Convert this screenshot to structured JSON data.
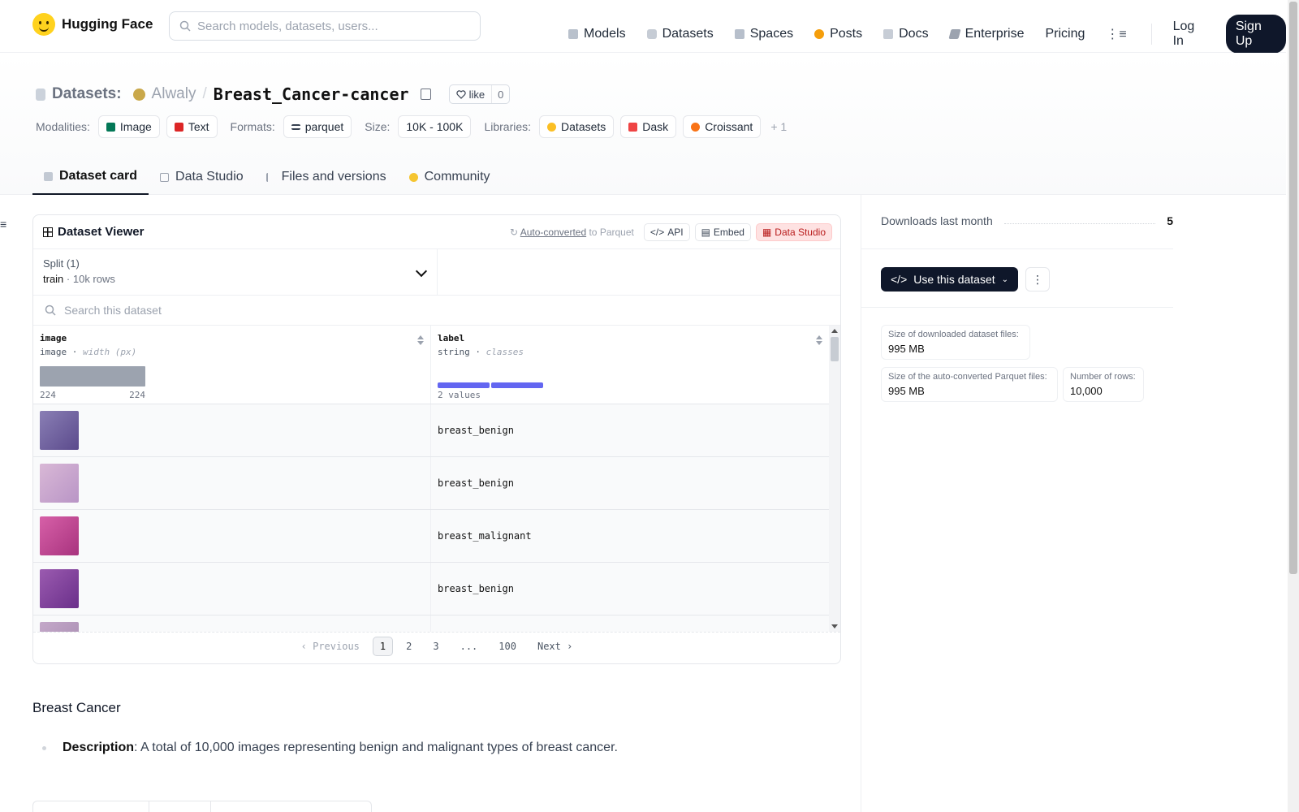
{
  "nav": {
    "brand": "Hugging Face",
    "search_placeholder": "Search models, datasets, users...",
    "items": [
      {
        "label": "Models",
        "icon": "cube-icon"
      },
      {
        "label": "Datasets",
        "icon": "database-icon"
      },
      {
        "label": "Spaces",
        "icon": "grid-icon"
      },
      {
        "label": "Posts",
        "icon": "dot-icon"
      },
      {
        "label": "Docs",
        "icon": "book-icon"
      },
      {
        "label": "Enterprise",
        "icon": "building-icon"
      },
      {
        "label": "Pricing",
        "icon": ""
      }
    ],
    "login": "Log In",
    "signup": "Sign Up"
  },
  "header": {
    "prefix": "Datasets:",
    "owner": "Alwaly",
    "separator": "/",
    "name": "Breast_Cancer-cancer",
    "like_label": "like",
    "like_count": "0",
    "modalities_label": "Modalities:",
    "modalities": [
      {
        "label": "Image",
        "color": "#047857"
      },
      {
        "label": "Text",
        "color": "#dc2626"
      }
    ],
    "formats_label": "Formats:",
    "format": "parquet",
    "size_label": "Size:",
    "size": "10K - 100K",
    "libraries_label": "Libraries:",
    "libraries": [
      {
        "label": "Datasets",
        "color": "#fbbf24"
      },
      {
        "label": "Dask",
        "color": "#ef4444"
      },
      {
        "label": "Croissant",
        "color": "#f97316"
      }
    ],
    "more_libraries": "+ 1"
  },
  "tabs": [
    {
      "label": "Dataset card",
      "active": true
    },
    {
      "label": "Data Studio",
      "active": false
    },
    {
      "label": "Files and versions",
      "active": false
    },
    {
      "label": "Community",
      "active": false
    }
  ],
  "viewer": {
    "title": "Dataset Viewer",
    "auto_converted": "Auto-converted",
    "to_parquet": " to Parquet",
    "api": "API",
    "embed": "Embed",
    "data_studio": "Data Studio",
    "split_label": "Split (1)",
    "split_name": "train",
    "split_dot": " · ",
    "split_rows": "10k rows",
    "search_placeholder": "Search this dataset",
    "columns": [
      {
        "name": "image",
        "type": "image",
        "detail": "width (px)",
        "range_min": "224",
        "range_max": "224"
      },
      {
        "name": "label",
        "type": "string",
        "detail": "classes",
        "values_text": "2 values"
      }
    ],
    "rows": [
      {
        "label": "breast_benign",
        "thumb": [
          "#8a7fb5",
          "#5b4a8c"
        ]
      },
      {
        "label": "breast_benign",
        "thumb": [
          "#d9b8d6",
          "#b995c6"
        ]
      },
      {
        "label": "breast_malignant",
        "thumb": [
          "#d760a8",
          "#a8337e"
        ]
      },
      {
        "label": "breast_benign",
        "thumb": [
          "#9b5bb0",
          "#6a2f8a"
        ]
      },
      {
        "label": "",
        "thumb": [
          "#c4a8c9",
          "#a58aaf"
        ]
      }
    ],
    "pagination": {
      "previous": "Previous",
      "pages": [
        "1",
        "2",
        "3",
        "...",
        "100"
      ],
      "next": "Next",
      "current": "1"
    }
  },
  "card": {
    "heading": "Breast Cancer",
    "desc_label": "Description",
    "desc_text": ": A total of 10,000 images representing benign and malignant types of breast cancer."
  },
  "sidebar": {
    "downloads_label": "Downloads last month",
    "downloads_value": "5",
    "use_button": "Use this dataset",
    "stats": [
      {
        "label": "Size of downloaded dataset files:",
        "value": "995 MB"
      },
      {
        "label": "Size of the auto-converted Parquet files:",
        "value": "995 MB"
      },
      {
        "label": "Number of rows:",
        "value": "10,000"
      }
    ]
  }
}
